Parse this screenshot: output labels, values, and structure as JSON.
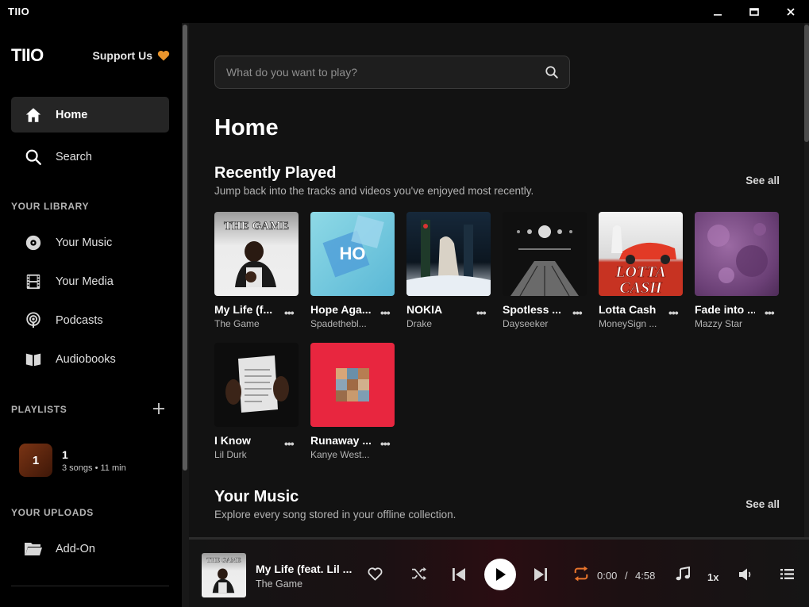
{
  "window": {
    "title": "TIIO"
  },
  "sidebar": {
    "brand": "TIIO",
    "support_label": "Support Us",
    "nav": [
      {
        "label": "Home",
        "icon": "home-icon",
        "active": true
      },
      {
        "label": "Search",
        "icon": "search-icon",
        "active": false
      }
    ],
    "library_heading": "YOUR LIBRARY",
    "library": [
      {
        "label": "Your Music",
        "icon": "disc-icon"
      },
      {
        "label": "Your Media",
        "icon": "film-icon"
      },
      {
        "label": "Podcasts",
        "icon": "podcast-icon"
      },
      {
        "label": "Audiobooks",
        "icon": "book-icon"
      }
    ],
    "playlists_heading": "PLAYLISTS",
    "playlists": [
      {
        "thumb_text": "1",
        "title": "1",
        "subtitle": "3 songs • 11 min"
      }
    ],
    "uploads_heading": "YOUR UPLOADS",
    "uploads": [
      {
        "label": "Add-On",
        "icon": "folder-icon"
      }
    ]
  },
  "main": {
    "search_placeholder": "What do you want to play?",
    "page_title": "Home",
    "recent": {
      "title": "Recently Played",
      "subtitle": "Jump back into the tracks and videos you've enjoyed most recently.",
      "see_all": "See all",
      "items": [
        {
          "title": "My Life (f...",
          "artist": "The Game"
        },
        {
          "title": "Hope Aga...",
          "artist": "Spadethebl..."
        },
        {
          "title": "NOKIA",
          "artist": "Drake"
        },
        {
          "title": "Spotless ...",
          "artist": "Dayseeker"
        },
        {
          "title": "Lotta Cash",
          "artist": "MoneySign ..."
        },
        {
          "title": "Fade into ...",
          "artist": "Mazzy Star"
        },
        {
          "title": "I Know",
          "artist": "Lil Durk"
        },
        {
          "title": "Runaway ...",
          "artist": "Kanye West..."
        }
      ],
      "more_label": "•••"
    },
    "your_music": {
      "title": "Your Music",
      "subtitle": "Explore every song stored in your offline collection.",
      "see_all": "See all"
    }
  },
  "player": {
    "title": "My Life (feat. Lil ...",
    "artist": "The Game",
    "current_time": "0:00",
    "separator": "/",
    "duration": "4:58",
    "rate": "1x",
    "accent": "#e8742c"
  }
}
